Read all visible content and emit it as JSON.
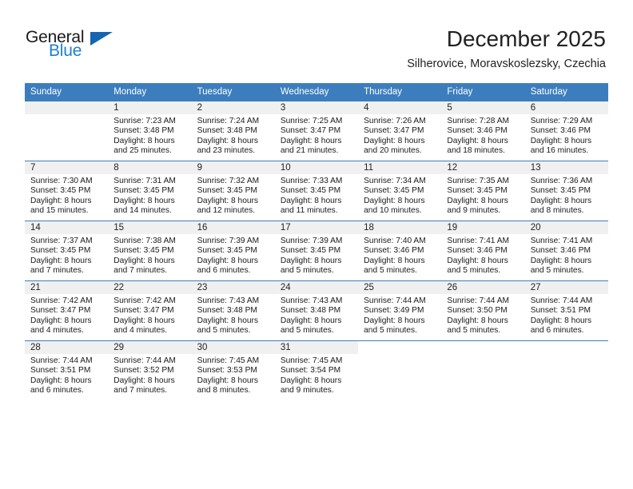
{
  "logo": {
    "word_one": "General",
    "word_two": "Blue",
    "accent_dark": "#1565b0",
    "accent_light": "#1f7fd0"
  },
  "header": {
    "month_title": "December 2025",
    "location": "Silherovice, Moravskoslezsky, Czechia"
  },
  "theme": {
    "header_bar": "#3c7ebd",
    "daynum_band": "#f0f0f0",
    "text": "#1a1a1a"
  },
  "weekday_headers": [
    "Sunday",
    "Monday",
    "Tuesday",
    "Wednesday",
    "Thursday",
    "Friday",
    "Saturday"
  ],
  "weeks": [
    [
      {
        "day": "",
        "sunrise": "",
        "sunset": "",
        "daylight_a": "",
        "daylight_b": ""
      },
      {
        "day": "1",
        "sunrise": "Sunrise: 7:23 AM",
        "sunset": "Sunset: 3:48 PM",
        "daylight_a": "Daylight: 8 hours",
        "daylight_b": "and 25 minutes."
      },
      {
        "day": "2",
        "sunrise": "Sunrise: 7:24 AM",
        "sunset": "Sunset: 3:48 PM",
        "daylight_a": "Daylight: 8 hours",
        "daylight_b": "and 23 minutes."
      },
      {
        "day": "3",
        "sunrise": "Sunrise: 7:25 AM",
        "sunset": "Sunset: 3:47 PM",
        "daylight_a": "Daylight: 8 hours",
        "daylight_b": "and 21 minutes."
      },
      {
        "day": "4",
        "sunrise": "Sunrise: 7:26 AM",
        "sunset": "Sunset: 3:47 PM",
        "daylight_a": "Daylight: 8 hours",
        "daylight_b": "and 20 minutes."
      },
      {
        "day": "5",
        "sunrise": "Sunrise: 7:28 AM",
        "sunset": "Sunset: 3:46 PM",
        "daylight_a": "Daylight: 8 hours",
        "daylight_b": "and 18 minutes."
      },
      {
        "day": "6",
        "sunrise": "Sunrise: 7:29 AM",
        "sunset": "Sunset: 3:46 PM",
        "daylight_a": "Daylight: 8 hours",
        "daylight_b": "and 16 minutes."
      }
    ],
    [
      {
        "day": "7",
        "sunrise": "Sunrise: 7:30 AM",
        "sunset": "Sunset: 3:45 PM",
        "daylight_a": "Daylight: 8 hours",
        "daylight_b": "and 15 minutes."
      },
      {
        "day": "8",
        "sunrise": "Sunrise: 7:31 AM",
        "sunset": "Sunset: 3:45 PM",
        "daylight_a": "Daylight: 8 hours",
        "daylight_b": "and 14 minutes."
      },
      {
        "day": "9",
        "sunrise": "Sunrise: 7:32 AM",
        "sunset": "Sunset: 3:45 PM",
        "daylight_a": "Daylight: 8 hours",
        "daylight_b": "and 12 minutes."
      },
      {
        "day": "10",
        "sunrise": "Sunrise: 7:33 AM",
        "sunset": "Sunset: 3:45 PM",
        "daylight_a": "Daylight: 8 hours",
        "daylight_b": "and 11 minutes."
      },
      {
        "day": "11",
        "sunrise": "Sunrise: 7:34 AM",
        "sunset": "Sunset: 3:45 PM",
        "daylight_a": "Daylight: 8 hours",
        "daylight_b": "and 10 minutes."
      },
      {
        "day": "12",
        "sunrise": "Sunrise: 7:35 AM",
        "sunset": "Sunset: 3:45 PM",
        "daylight_a": "Daylight: 8 hours",
        "daylight_b": "and 9 minutes."
      },
      {
        "day": "13",
        "sunrise": "Sunrise: 7:36 AM",
        "sunset": "Sunset: 3:45 PM",
        "daylight_a": "Daylight: 8 hours",
        "daylight_b": "and 8 minutes."
      }
    ],
    [
      {
        "day": "14",
        "sunrise": "Sunrise: 7:37 AM",
        "sunset": "Sunset: 3:45 PM",
        "daylight_a": "Daylight: 8 hours",
        "daylight_b": "and 7 minutes."
      },
      {
        "day": "15",
        "sunrise": "Sunrise: 7:38 AM",
        "sunset": "Sunset: 3:45 PM",
        "daylight_a": "Daylight: 8 hours",
        "daylight_b": "and 7 minutes."
      },
      {
        "day": "16",
        "sunrise": "Sunrise: 7:39 AM",
        "sunset": "Sunset: 3:45 PM",
        "daylight_a": "Daylight: 8 hours",
        "daylight_b": "and 6 minutes."
      },
      {
        "day": "17",
        "sunrise": "Sunrise: 7:39 AM",
        "sunset": "Sunset: 3:45 PM",
        "daylight_a": "Daylight: 8 hours",
        "daylight_b": "and 5 minutes."
      },
      {
        "day": "18",
        "sunrise": "Sunrise: 7:40 AM",
        "sunset": "Sunset: 3:46 PM",
        "daylight_a": "Daylight: 8 hours",
        "daylight_b": "and 5 minutes."
      },
      {
        "day": "19",
        "sunrise": "Sunrise: 7:41 AM",
        "sunset": "Sunset: 3:46 PM",
        "daylight_a": "Daylight: 8 hours",
        "daylight_b": "and 5 minutes."
      },
      {
        "day": "20",
        "sunrise": "Sunrise: 7:41 AM",
        "sunset": "Sunset: 3:46 PM",
        "daylight_a": "Daylight: 8 hours",
        "daylight_b": "and 5 minutes."
      }
    ],
    [
      {
        "day": "21",
        "sunrise": "Sunrise: 7:42 AM",
        "sunset": "Sunset: 3:47 PM",
        "daylight_a": "Daylight: 8 hours",
        "daylight_b": "and 4 minutes."
      },
      {
        "day": "22",
        "sunrise": "Sunrise: 7:42 AM",
        "sunset": "Sunset: 3:47 PM",
        "daylight_a": "Daylight: 8 hours",
        "daylight_b": "and 4 minutes."
      },
      {
        "day": "23",
        "sunrise": "Sunrise: 7:43 AM",
        "sunset": "Sunset: 3:48 PM",
        "daylight_a": "Daylight: 8 hours",
        "daylight_b": "and 5 minutes."
      },
      {
        "day": "24",
        "sunrise": "Sunrise: 7:43 AM",
        "sunset": "Sunset: 3:48 PM",
        "daylight_a": "Daylight: 8 hours",
        "daylight_b": "and 5 minutes."
      },
      {
        "day": "25",
        "sunrise": "Sunrise: 7:44 AM",
        "sunset": "Sunset: 3:49 PM",
        "daylight_a": "Daylight: 8 hours",
        "daylight_b": "and 5 minutes."
      },
      {
        "day": "26",
        "sunrise": "Sunrise: 7:44 AM",
        "sunset": "Sunset: 3:50 PM",
        "daylight_a": "Daylight: 8 hours",
        "daylight_b": "and 5 minutes."
      },
      {
        "day": "27",
        "sunrise": "Sunrise: 7:44 AM",
        "sunset": "Sunset: 3:51 PM",
        "daylight_a": "Daylight: 8 hours",
        "daylight_b": "and 6 minutes."
      }
    ],
    [
      {
        "day": "28",
        "sunrise": "Sunrise: 7:44 AM",
        "sunset": "Sunset: 3:51 PM",
        "daylight_a": "Daylight: 8 hours",
        "daylight_b": "and 6 minutes."
      },
      {
        "day": "29",
        "sunrise": "Sunrise: 7:44 AM",
        "sunset": "Sunset: 3:52 PM",
        "daylight_a": "Daylight: 8 hours",
        "daylight_b": "and 7 minutes."
      },
      {
        "day": "30",
        "sunrise": "Sunrise: 7:45 AM",
        "sunset": "Sunset: 3:53 PM",
        "daylight_a": "Daylight: 8 hours",
        "daylight_b": "and 8 minutes."
      },
      {
        "day": "31",
        "sunrise": "Sunrise: 7:45 AM",
        "sunset": "Sunset: 3:54 PM",
        "daylight_a": "Daylight: 8 hours",
        "daylight_b": "and 9 minutes."
      },
      {
        "day": "",
        "sunrise": "",
        "sunset": "",
        "daylight_a": "",
        "daylight_b": ""
      },
      {
        "day": "",
        "sunrise": "",
        "sunset": "",
        "daylight_a": "",
        "daylight_b": ""
      },
      {
        "day": "",
        "sunrise": "",
        "sunset": "",
        "daylight_a": "",
        "daylight_b": ""
      }
    ]
  ]
}
